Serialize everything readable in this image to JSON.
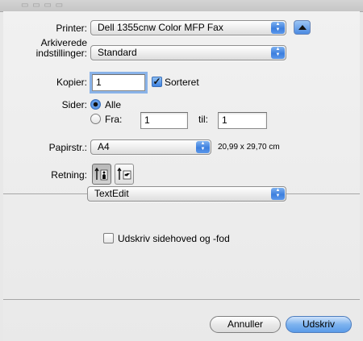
{
  "printer": {
    "label": "Printer:",
    "value": "Dell 1355cnw Color MFP Fax"
  },
  "presets": {
    "label_line1": "Arkiverede",
    "label_line2": "indstillinger:",
    "value": "Standard"
  },
  "copies": {
    "label": "Kopier:",
    "value": "1",
    "collate_label": "Sorteret",
    "collate_checked": true
  },
  "pages": {
    "label": "Sider:",
    "all_label": "Alle",
    "from_label": "Fra:",
    "from_value": "1",
    "to_label": "til:",
    "to_value": "1",
    "selected": "all"
  },
  "paper": {
    "label": "Papirstr.:",
    "value": "A4",
    "dimensions": "20,99 x 29,70 cm"
  },
  "orientation": {
    "label": "Retning:",
    "selected": "portrait",
    "options": [
      "portrait",
      "landscape"
    ]
  },
  "section": {
    "value": "TextEdit"
  },
  "header_footer": {
    "label": "Udskriv sidehoved og -fod",
    "checked": false
  },
  "buttons": {
    "cancel": "Annuller",
    "print": "Udskriv"
  },
  "colors": {
    "accent": "#3d7fde",
    "focus_ring": "#8ab3e8",
    "sheet_bg": "#ececec"
  }
}
